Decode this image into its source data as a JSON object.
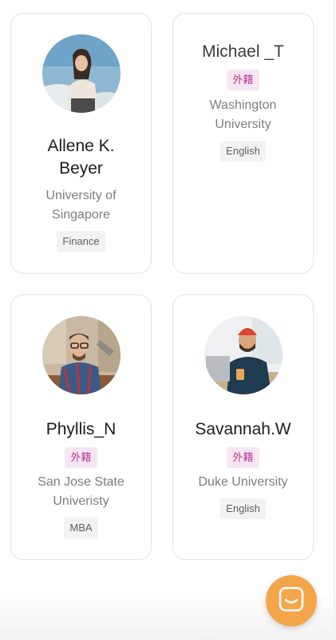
{
  "profiles": [
    {
      "name": "Allene K. Beyer",
      "school": "University of Singapore",
      "subject": "Finance",
      "foreign_tag": "",
      "avatar": "avatar-woman-sky-photo"
    },
    {
      "name": "Michael _T",
      "school": "Washington University",
      "subject": "English",
      "foreign_tag": "外籍",
      "avatar": ""
    },
    {
      "name": "Phyllis_N",
      "school": "San Jose State Univeristy",
      "subject": "MBA",
      "foreign_tag": "外籍",
      "avatar": "avatar-man-glasses-plaid-photo"
    },
    {
      "name": "Savannah.W",
      "school": "Duke University",
      "subject": "English",
      "foreign_tag": "外籍",
      "avatar": "avatar-man-beanie-laptop-photo"
    }
  ],
  "chat": {
    "icon": "chat-bubble-icon",
    "color": "#f4a54a"
  },
  "colors": {
    "foreign_tag_bg": "#f6e6f3",
    "foreign_tag_text": "#b8378f",
    "subject_tag_bg": "#f2f2f2"
  }
}
